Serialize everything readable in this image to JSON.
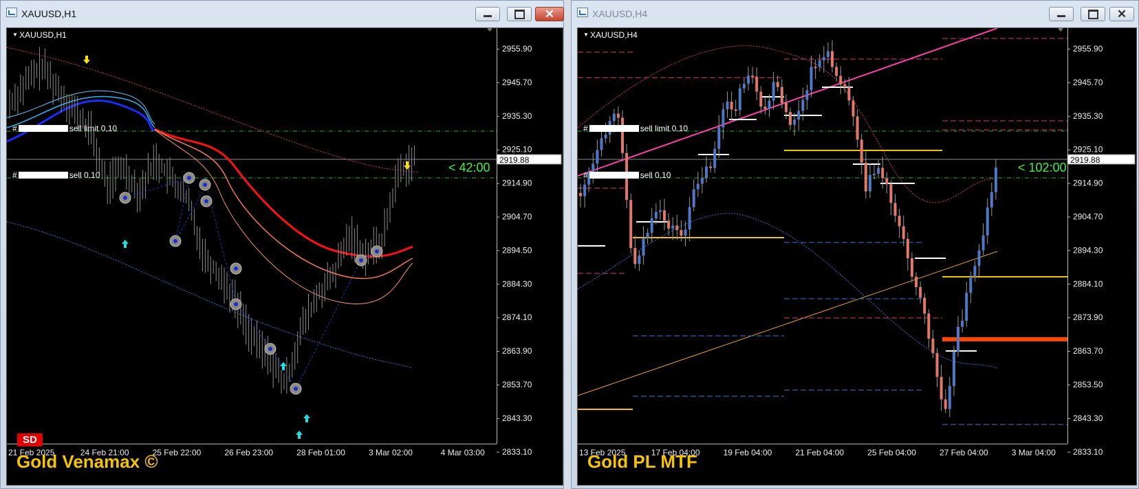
{
  "windows": [
    {
      "title": "XAUUSD,H1",
      "symbol": "XAUUSD,H1",
      "orders": [
        "sell limit 0.10",
        "sell 0.10"
      ],
      "order_prefix": "#",
      "price_ticks": [
        "2955.90",
        "2945.70",
        "2935.30",
        "2925.10",
        "2914.90",
        "2904.70",
        "2894.50",
        "2884.30",
        "2874.10",
        "2863.90",
        "2853.70",
        "2843.30",
        "2833.10"
      ],
      "current_price": "2919.88",
      "time_ticks": [
        "21 Feb 2025",
        "24 Feb 21:00",
        "25 Feb 22:00",
        "26 Feb 23:00",
        "28 Feb 01:00",
        "3 Mar 02:00",
        "4 Mar 03:00"
      ],
      "timer": "< 42:00",
      "brand": "Gold Venamax ©",
      "badge": "SD"
    },
    {
      "title": "XAUUSD,H4",
      "symbol": "XAUUSD,H4",
      "orders": [
        "sell limit 0.10",
        "sell 0.10"
      ],
      "order_prefix": "#",
      "price_ticks": [
        "2955.90",
        "2945.70",
        "2935.30",
        "2925.10",
        "2914.90",
        "2904.70",
        "2894.30",
        "2884.10",
        "2873.90",
        "2863.70",
        "2853.50",
        "2843.30",
        "2833.10"
      ],
      "current_price": "2919.88",
      "time_ticks": [
        "13 Feb 2025",
        "17 Feb 04:00",
        "19 Feb 04:00",
        "21 Feb 04:00",
        "25 Feb 04:00",
        "27 Feb 04:00",
        "3 Mar 04:00"
      ],
      "timer": "< 102:00",
      "brand": "Gold PL MTF"
    }
  ],
  "colors": {
    "chart_bg": "#000000",
    "bull": "#4f79c7",
    "bear": "#e1786a",
    "timer": "#3cf23c",
    "brand": "#f5c300",
    "badge": "#e00000"
  },
  "icons": {
    "minimize": "minimize-icon",
    "maximize": "maximize-icon",
    "close": "close-icon",
    "app": "chart-window-icon"
  }
}
